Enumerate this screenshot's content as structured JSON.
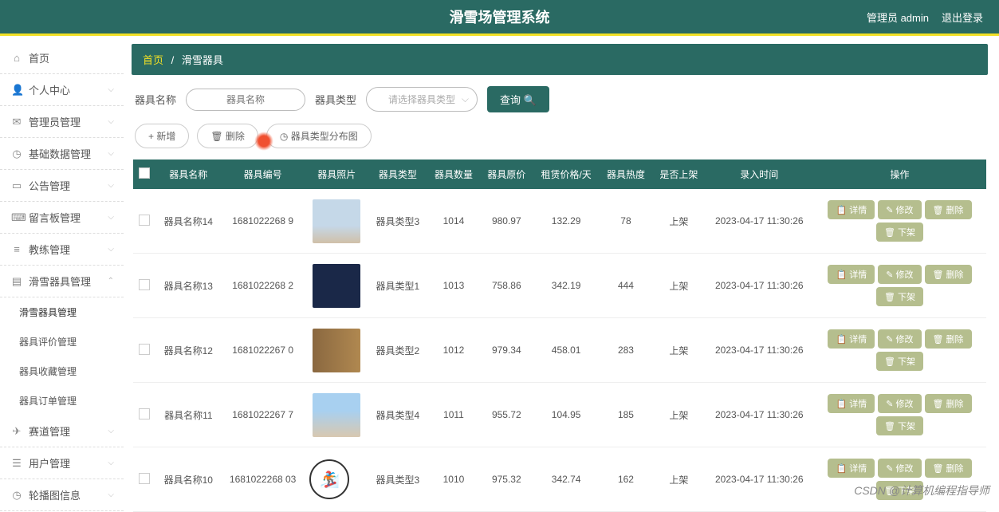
{
  "header": {
    "title": "滑雪场管理系统",
    "admin_label": "管理员 admin",
    "logout_label": "退出登录"
  },
  "sidebar": {
    "items": [
      {
        "icon": "⌂",
        "label": "首页"
      },
      {
        "icon": "👤",
        "label": "个人中心",
        "arrow": "⌵"
      },
      {
        "icon": "✉",
        "label": "管理员管理",
        "arrow": "⌵"
      },
      {
        "icon": "◷",
        "label": "基础数据管理",
        "arrow": "⌵"
      },
      {
        "icon": "▭",
        "label": "公告管理",
        "arrow": "⌵"
      },
      {
        "icon": "⌨",
        "label": "留言板管理",
        "arrow": "⌵"
      },
      {
        "icon": "≡",
        "label": "教练管理",
        "arrow": "⌵"
      },
      {
        "icon": "▤",
        "label": "滑雪器具管理",
        "arrow": "⌃"
      },
      {
        "icon": "✈",
        "label": "赛道管理",
        "arrow": "⌵"
      },
      {
        "icon": "☰",
        "label": "用户管理",
        "arrow": "⌵"
      },
      {
        "icon": "◷",
        "label": "轮播图信息",
        "arrow": "⌵"
      }
    ],
    "submenu": [
      {
        "label": "滑雪器具管理",
        "active": true
      },
      {
        "label": "器具评价管理"
      },
      {
        "label": "器具收藏管理"
      },
      {
        "label": "器具订单管理"
      }
    ]
  },
  "breadcrumb": {
    "home": "首页",
    "sep": "/",
    "current": "滑雪器具"
  },
  "search": {
    "name_label": "器具名称",
    "name_placeholder": "器具名称",
    "type_label": "器具类型",
    "type_placeholder": "请选择器具类型",
    "query_btn": "查询 🔍"
  },
  "actions": {
    "add": "+ 新增",
    "delete": "🗑 删除",
    "chart": "◷ 器具类型分布图"
  },
  "table": {
    "headers": [
      "",
      "器具名称",
      "器具编号",
      "器具照片",
      "器具类型",
      "器具数量",
      "器具原价",
      "租赁价格/天",
      "器具热度",
      "是否上架",
      "录入时间",
      "操作"
    ],
    "rows": [
      {
        "name": "器具名称14",
        "code": "1681022268 9",
        "type": "器具类型3",
        "qty": "1014",
        "price": "980.97",
        "rent": "132.29",
        "heat": "78",
        "shelf": "上架",
        "time": "2023-04-17 11:30:26"
      },
      {
        "name": "器具名称13",
        "code": "1681022268 2",
        "type": "器具类型1",
        "qty": "1013",
        "price": "758.86",
        "rent": "342.19",
        "heat": "444",
        "shelf": "上架",
        "time": "2023-04-17 11:30:26"
      },
      {
        "name": "器具名称12",
        "code": "1681022267 0",
        "type": "器具类型2",
        "qty": "1012",
        "price": "979.34",
        "rent": "458.01",
        "heat": "283",
        "shelf": "上架",
        "time": "2023-04-17 11:30:26"
      },
      {
        "name": "器具名称11",
        "code": "1681022267 7",
        "type": "器具类型4",
        "qty": "1011",
        "price": "955.72",
        "rent": "104.95",
        "heat": "185",
        "shelf": "上架",
        "time": "2023-04-17 11:30:26"
      },
      {
        "name": "器具名称10",
        "code": "1681022268 03",
        "type": "器具类型3",
        "qty": "1010",
        "price": "975.32",
        "rent": "342.74",
        "heat": "162",
        "shelf": "上架",
        "time": "2023-04-17 11:30:26"
      }
    ],
    "ops": {
      "detail": "📋 详情",
      "edit": "✎ 修改",
      "delete": "🗑 删除",
      "offshelf": "🗑 下架"
    }
  },
  "watermark": "CSDN @计算机编程指导师"
}
